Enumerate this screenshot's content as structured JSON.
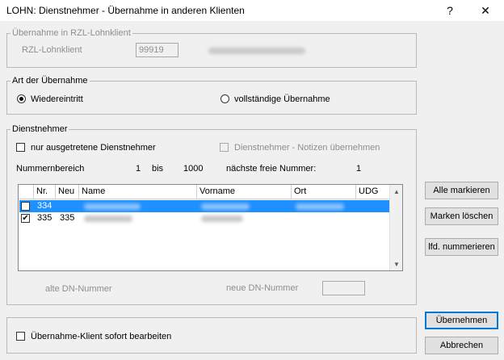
{
  "window": {
    "title": "LOHN: Dienstnehmer - Übernahme in anderen Klienten",
    "help_glyph": "?",
    "close_glyph": "✕"
  },
  "rzl_group": {
    "legend": "Übernahme in RZL-Lohnklient",
    "label": "RZL-Lohnklient",
    "value": "99919"
  },
  "art_group": {
    "legend": "Art der Übernahme",
    "option_wieder": "Wiedereintritt",
    "option_vollst": "vollständige Übernahme",
    "selected": "Wiedereintritt"
  },
  "dn_group": {
    "legend": "Dienstnehmer",
    "only_left_label": "nur ausgetretene Dienstnehmer",
    "notes_label": "Dienstnehmer - Notizen übernehmen",
    "range_label": "Nummernbereich",
    "range_from": "1",
    "range_bis": "bis",
    "range_to": "1000",
    "next_free_label": "nächste freie Nummer:",
    "next_free_value": "1",
    "alte_label": "alte DN-Nummer",
    "neue_label": "neue DN-Nummer"
  },
  "table": {
    "columns": [
      "Nr.",
      "Neu",
      "Name",
      "Vorname",
      "Ort",
      "UDG"
    ],
    "rows": [
      {
        "checked": false,
        "nr": "334",
        "neu": "",
        "selected": true
      },
      {
        "checked": true,
        "nr": "335",
        "neu": "335",
        "selected": false
      }
    ],
    "scroll_up": "▲",
    "scroll_down": "▼"
  },
  "buttons": {
    "alle_markieren": "Alle markieren",
    "marken_loeschen": "Marken löschen",
    "lfd_nummerieren": "lfd. nummerieren",
    "uebernehmen": "Übernehmen",
    "abbrechen": "Abbrechen"
  },
  "bottom_group": {
    "edit_label": "Übernahme-Klient sofort bearbeiten"
  },
  "colors": {
    "selection": "#1e90ff",
    "focus_border": "#0078d7"
  }
}
